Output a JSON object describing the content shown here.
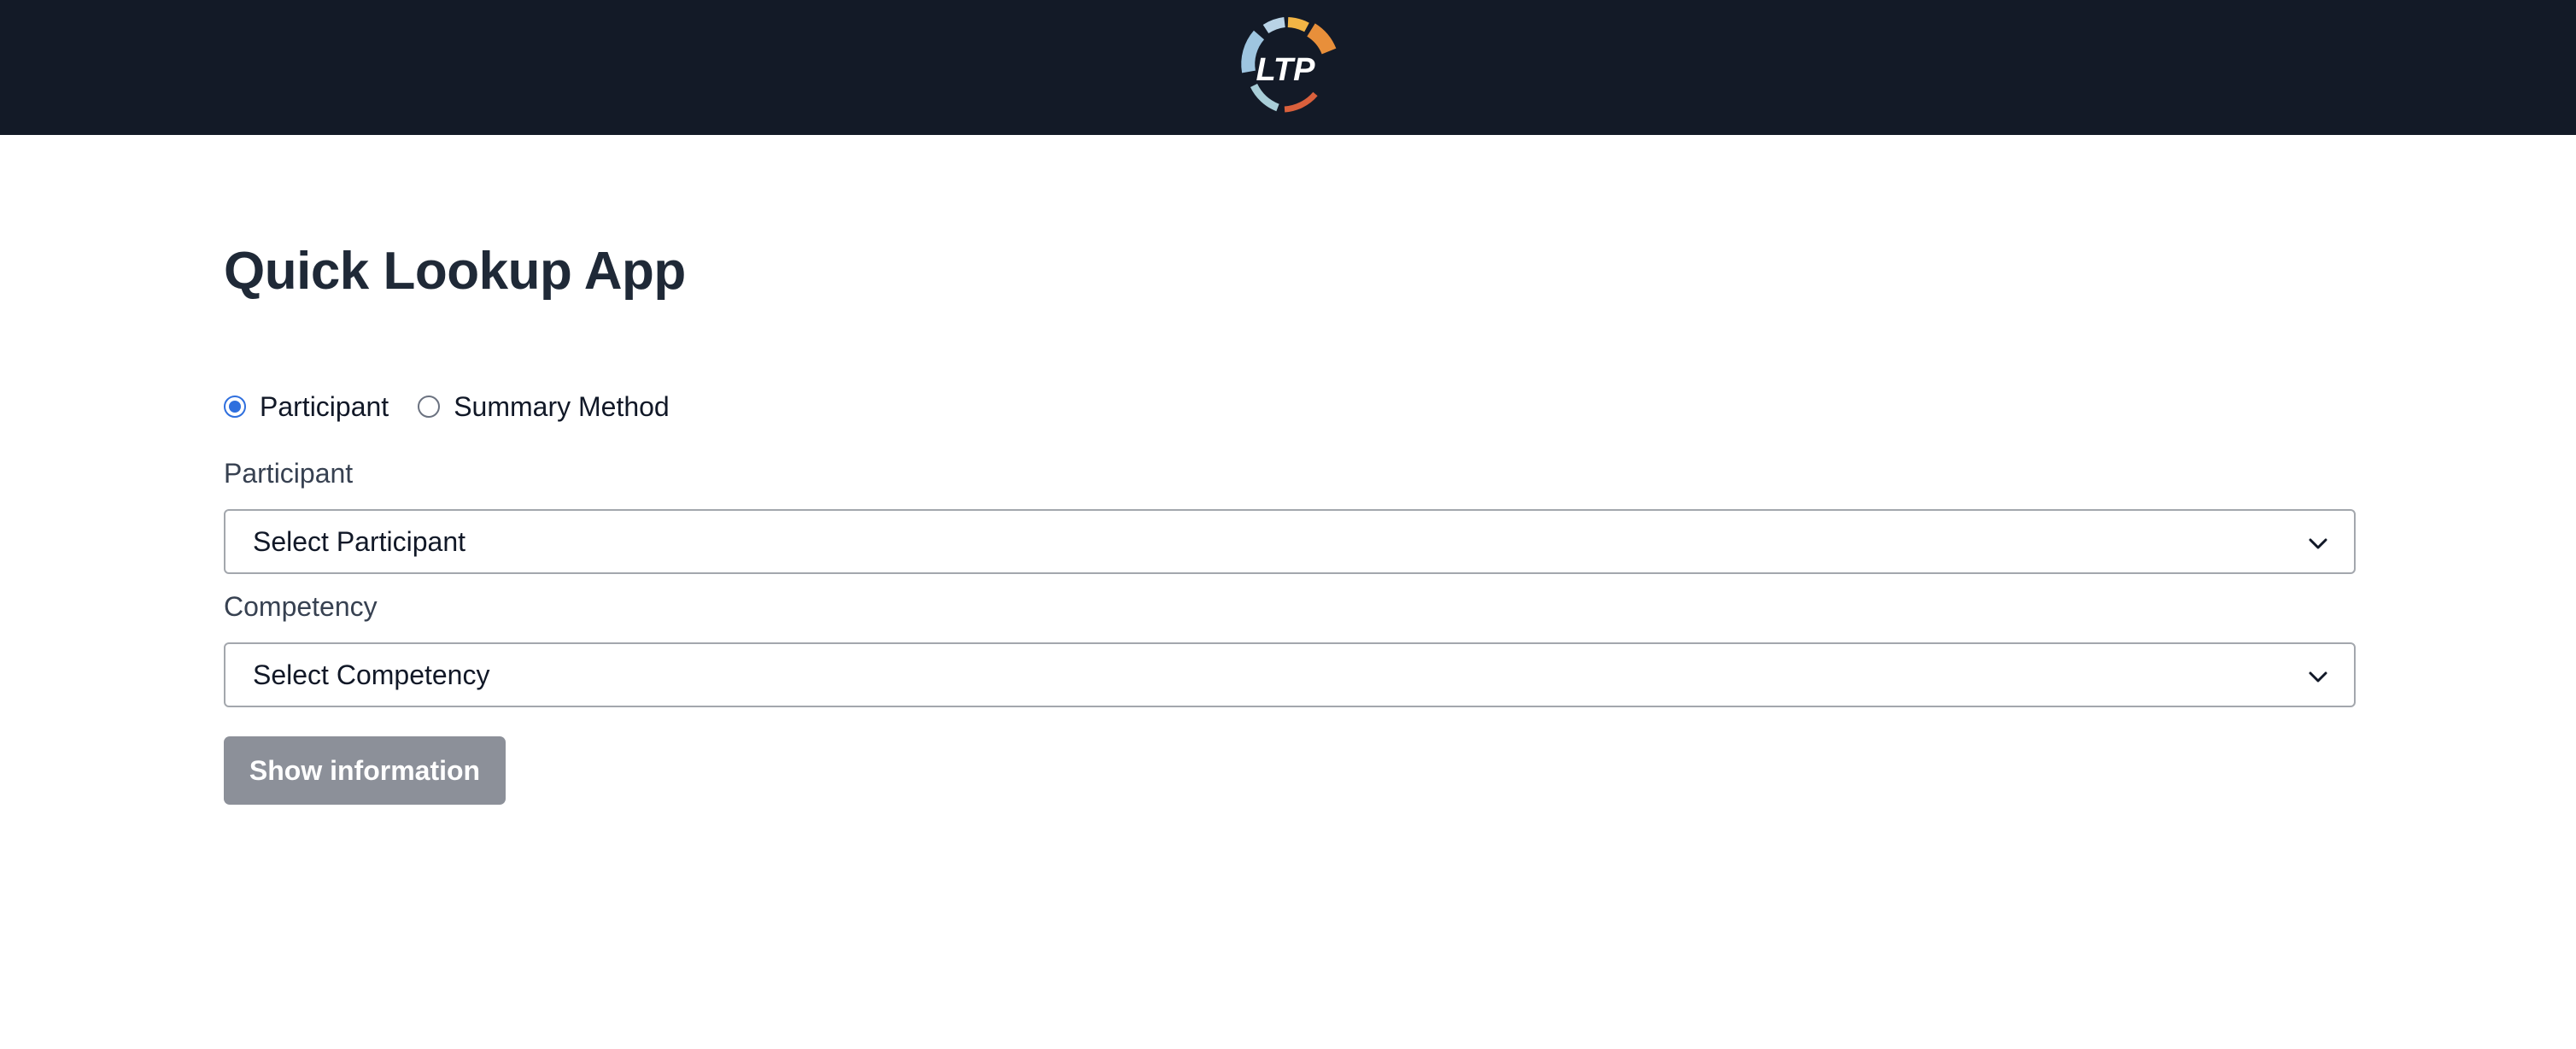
{
  "header": {
    "logo_text": "LTP",
    "background": "#131a27"
  },
  "page": {
    "title": "Quick Lookup App"
  },
  "mode_selector": {
    "options": [
      {
        "label": "Participant",
        "checked": true
      },
      {
        "label": "Summary Method",
        "checked": false
      }
    ]
  },
  "participant_field": {
    "label": "Participant",
    "selected": "Select Participant"
  },
  "competency_field": {
    "label": "Competency",
    "selected": "Select Competency"
  },
  "actions": {
    "show_label": "Show information",
    "enabled": false
  },
  "colors": {
    "accent": "#2f6fde",
    "button_disabled": "#8c9099",
    "title": "#1f2937"
  }
}
